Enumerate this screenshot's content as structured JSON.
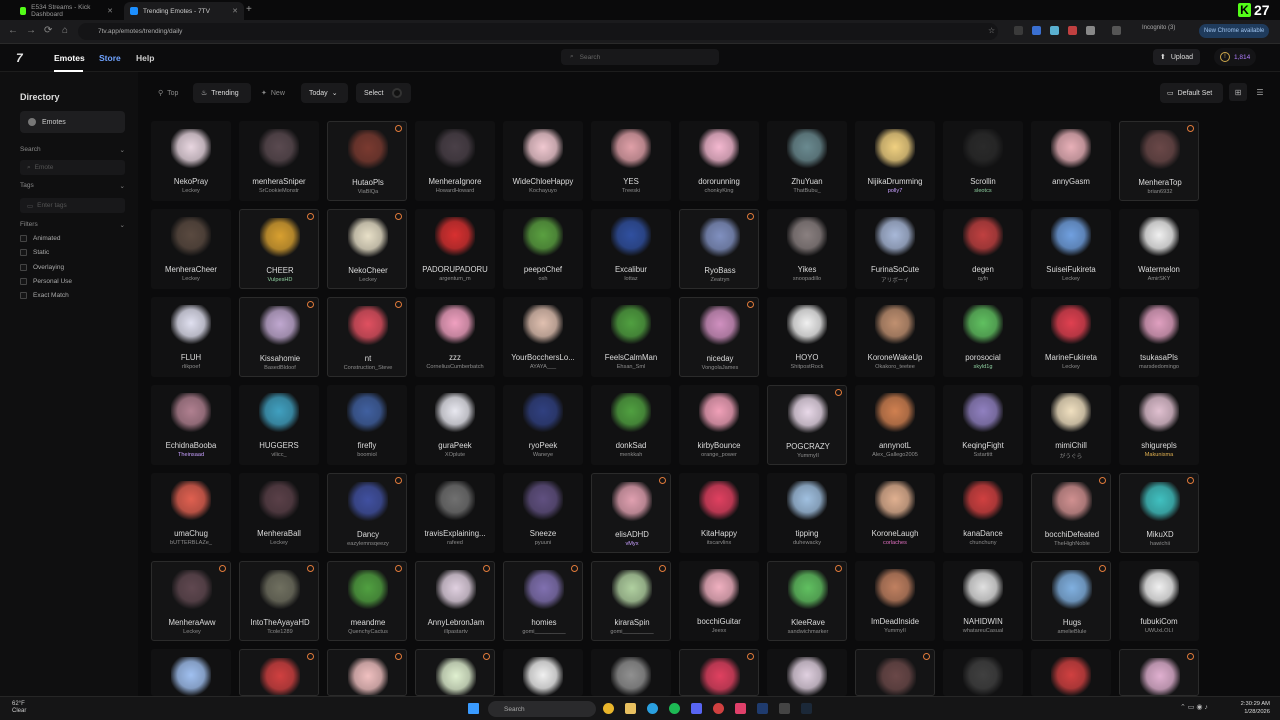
{
  "browser": {
    "tabs": [
      {
        "title": "E534 Streams - Kick Dashboard",
        "active": false
      },
      {
        "title": "Trending Emotes - 7TV",
        "active": true
      }
    ],
    "url": "7tv.app/emotes/trending/daily",
    "incognito_label": "Incognito (3)",
    "new_chrome_label": "New Chrome available",
    "overlay_badge": "27"
  },
  "header": {
    "logo": "7",
    "nav": [
      "Emotes",
      "Store",
      "Help"
    ],
    "search_placeholder": "Search",
    "upload_label": "Upload",
    "coins": "1,814"
  },
  "sidebar": {
    "title": "Directory",
    "emotes_label": "Emotes",
    "search_section": "Search",
    "search_placeholder": "Emote",
    "tags_section": "Tags",
    "tags_placeholder": "Enter tags",
    "filters_section": "Filters",
    "filters": [
      "Animated",
      "Static",
      "Overlaying",
      "Personal Use",
      "Exact Match"
    ]
  },
  "toolbar": {
    "top": "Top",
    "trending": "Trending",
    "new": "New",
    "period": "Today",
    "select": "Select",
    "default_set": "Default Set"
  },
  "emotes": [
    {
      "name": "NekoPray",
      "author": "Leckey",
      "color": "#e8d6e0",
      "bordered": false
    },
    {
      "name": "menheraSniper",
      "author": "SrCookieMonstr",
      "color": "#5a4a50",
      "bordered": false
    },
    {
      "name": "HutaoPls",
      "author": "ViaBlQa",
      "color": "#7a3a30",
      "bordered": true
    },
    {
      "name": "MenheraIgnore",
      "author": "HowardHoward",
      "color": "#4a4048",
      "bordered": false
    },
    {
      "name": "WideChloeHappy",
      "author": "Kochayuyo",
      "color": "#f0c8d0",
      "bordered": false
    },
    {
      "name": "YES",
      "author": "Treeski",
      "color": "#e0a0a8",
      "bordered": false
    },
    {
      "name": "dororunning",
      "author": "chonkyKing",
      "color": "#f4b8d0",
      "bordered": false
    },
    {
      "name": "ZhuYuan",
      "author": "ThatBubu_",
      "color": "#6a8a90",
      "bordered": false
    },
    {
      "name": "NijikaDrumming",
      "author": "polly7",
      "authorColor": "#c8a0ff",
      "color": "#f0d080",
      "bordered": false
    },
    {
      "name": "Scrollin",
      "author": "sleotcs",
      "authorColor": "#8fd0a0",
      "color": "#2a2a2a",
      "bordered": false
    },
    {
      "name": "annyGasm",
      "author": "",
      "color": "#e8b0b8",
      "bordered": false
    },
    {
      "name": "MenheraTop",
      "author": "brian6932",
      "color": "#6a4848",
      "bordered": true
    },
    {
      "name": "MenheraCheer",
      "author": "Leckey",
      "color": "#5a4a40",
      "bordered": false
    },
    {
      "name": "CHEER",
      "author": "VulpesHD",
      "authorColor": "#8fd0a0",
      "color": "#d8a030",
      "bordered": true
    },
    {
      "name": "NekoCheer",
      "author": "Leckey",
      "color": "#e8e0c8",
      "bordered": true
    },
    {
      "name": "PADORUPADORU",
      "author": "argentum_m",
      "color": "#d83030",
      "bordered": false
    },
    {
      "name": "peepoChef",
      "author": "osh",
      "color": "#5aa040",
      "bordered": false
    },
    {
      "name": "Excalibur",
      "author": "lottaz",
      "color": "#3050a0",
      "bordered": false
    },
    {
      "name": "RyoBass",
      "author": "Zeatryn",
      "color": "#8090c0",
      "bordered": true
    },
    {
      "name": "Yikes",
      "author": "snoopadillo",
      "color": "#8a8080",
      "bordered": false
    },
    {
      "name": "FurinaSoCute",
      "author": "アリボーイ",
      "color": "#a8b8d8",
      "bordered": false
    },
    {
      "name": "degen",
      "author": "qyfn",
      "color": "#c04040",
      "bordered": false
    },
    {
      "name": "SuiseiFukireta",
      "author": "Leckey",
      "color": "#70a0e0",
      "bordered": false
    },
    {
      "name": "Watermelon",
      "author": "AmirSKY",
      "color": "#f0f0f0",
      "bordered": false
    },
    {
      "name": "FLUH",
      "author": "rlikpoef",
      "color": "#e0e0f0",
      "bordered": false
    },
    {
      "name": "Kissahomie",
      "author": "BasedBldoof",
      "color": "#c0a8d0",
      "bordered": true
    },
    {
      "name": "nt",
      "author": "Construction_Steve",
      "color": "#e05060",
      "bordered": true
    },
    {
      "name": "zzz",
      "author": "CorneliusCumberbatch",
      "color": "#f0a0c0",
      "bordered": false
    },
    {
      "name": "YourBocchersLo...",
      "author": "AYAYA___",
      "color": "#e0c0b0",
      "bordered": false
    },
    {
      "name": "FeelsCalmMan",
      "author": "Ehsan_Sml",
      "color": "#50a040",
      "bordered": false
    },
    {
      "name": "niceday",
      "author": "VongolaJames",
      "color": "#d090c0",
      "bordered": true
    },
    {
      "name": "HOYO",
      "author": "ShitpostRock",
      "color": "#f0f0f0",
      "bordered": false
    },
    {
      "name": "KoroneWakeUp",
      "author": "Okakoro_teetee",
      "color": "#c09070",
      "bordered": false
    },
    {
      "name": "porosocial",
      "author": "skyld1g",
      "authorColor": "#8fd0a0",
      "color": "#60c060",
      "bordered": false
    },
    {
      "name": "MarineFukireta",
      "author": "Leckey",
      "color": "#e04050",
      "bordered": false
    },
    {
      "name": "tsukasaPls",
      "author": "marsdedomingo",
      "color": "#e0a0c0",
      "bordered": false
    },
    {
      "name": "EchidnaBooba",
      "author": "Theinsaad",
      "authorColor": "#c8a0ff",
      "color": "#b08090",
      "bordered": false
    },
    {
      "name": "HUGGERS",
      "author": "vilicc_",
      "color": "#40a0c0",
      "bordered": false
    },
    {
      "name": "firefly",
      "author": "boomiol",
      "color": "#4060a0",
      "bordered": false
    },
    {
      "name": "guraPeek",
      "author": "XOplute",
      "color": "#e8e8f0",
      "bordered": false
    },
    {
      "name": "ryoPeek",
      "author": "Waneye",
      "color": "#304080",
      "bordered": false
    },
    {
      "name": "donkSad",
      "author": "menkkah",
      "color": "#50a040",
      "bordered": false
    },
    {
      "name": "kirbyBounce",
      "author": "orange_power",
      "color": "#f0a0b8",
      "bordered": false
    },
    {
      "name": "POGCRAZY",
      "author": "YummyII",
      "color": "#e8d8e8",
      "bordered": true
    },
    {
      "name": "annynotL",
      "author": "Alex_Gallego2005",
      "color": "#d08050",
      "bordered": false
    },
    {
      "name": "KeqingFight",
      "author": "Sstartitt",
      "color": "#9080c0",
      "bordered": false
    },
    {
      "name": "mimiChill",
      "author": "がうぐら",
      "color": "#f0e0c0",
      "bordered": false
    },
    {
      "name": "shigurepls",
      "author": "Makunisma",
      "authorColor": "#e0b050",
      "color": "#e0c0d0",
      "bordered": false
    },
    {
      "name": "umaChug",
      "author": "bUTTERBLAZe_",
      "color": "#e06050",
      "bordered": false
    },
    {
      "name": "MenheraBall",
      "author": "Leckey",
      "color": "#5a4048",
      "bordered": false
    },
    {
      "name": "Dancy",
      "author": "eazylemnsqeezy",
      "color": "#4050a0",
      "bordered": true
    },
    {
      "name": "travisExplaining...",
      "author": "rafeed",
      "color": "#707070",
      "bordered": false
    },
    {
      "name": "Sneeze",
      "author": "pyuuni",
      "color": "#605080",
      "bordered": false
    },
    {
      "name": "elisADHD",
      "author": "vMyx",
      "authorColor": "#c8a0ff",
      "color": "#e0a0b0",
      "bordered": true
    },
    {
      "name": "KitaHappy",
      "author": "itscarvlinx",
      "color": "#e04060",
      "bordered": false
    },
    {
      "name": "tipping",
      "author": "duhewacky",
      "color": "#a0c0e0",
      "bordered": false
    },
    {
      "name": "KoroneLaugh",
      "author": "corlaches",
      "authorColor": "#e070c0",
      "color": "#e0b090",
      "bordered": false
    },
    {
      "name": "kanaDance",
      "author": "chunchuny",
      "color": "#d04040",
      "bordered": false
    },
    {
      "name": "bocchiDefeated",
      "author": "TheHighNoble",
      "color": "#d09090",
      "bordered": true
    },
    {
      "name": "MikuXD",
      "author": "hawichii",
      "color": "#40c0c0",
      "bordered": true
    },
    {
      "name": "MenheraAww",
      "author": "Leckey",
      "color": "#604850",
      "bordered": true
    },
    {
      "name": "IntoTheAyayaHD",
      "author": "Tcole1289",
      "color": "#707060",
      "bordered": true
    },
    {
      "name": "meandme",
      "author": "QuenchyCactus",
      "color": "#50a040",
      "bordered": true
    },
    {
      "name": "AnnyLebronJam",
      "author": "illpastartv",
      "color": "#e0d0e0",
      "bordered": true
    },
    {
      "name": "homies",
      "author": "gomi__________",
      "color": "#8070b0",
      "bordered": true
    },
    {
      "name": "kiraraSpin",
      "author": "gomi__________",
      "color": "#b0d0a0",
      "bordered": true
    },
    {
      "name": "bocchiGuitar",
      "author": "Jeexx",
      "color": "#f0b0c0",
      "bordered": false
    },
    {
      "name": "KleeRave",
      "author": "sandwichmarker",
      "color": "#60c060",
      "bordered": true
    },
    {
      "name": "ImDeadInside",
      "author": "YummyII",
      "color": "#c08060",
      "bordered": false
    },
    {
      "name": "NAHIDWIN",
      "author": "whatareuCasual",
      "color": "#e0e0e0",
      "bordered": false
    },
    {
      "name": "Hugs",
      "author": "amelieBlule",
      "color": "#80b0e0",
      "bordered": true
    },
    {
      "name": "fubukiCom",
      "author": "UWUxLOLI",
      "color": "#f0f0f0",
      "bordered": false
    },
    {
      "name": "",
      "author": "",
      "color": "#a0c0f0",
      "bordered": false
    },
    {
      "name": "",
      "author": "",
      "color": "#d04040",
      "bordered": true
    },
    {
      "name": "",
      "author": "",
      "color": "#f0c0c0",
      "bordered": true
    },
    {
      "name": "",
      "author": "",
      "color": "#e0f0d0",
      "bordered": true
    },
    {
      "name": "",
      "author": "",
      "color": "#f0f0f0",
      "bordered": false
    },
    {
      "name": "",
      "author": "",
      "color": "#909090",
      "bordered": false
    },
    {
      "name": "",
      "author": "",
      "color": "#e04060",
      "bordered": true
    },
    {
      "name": "",
      "author": "",
      "color": "#e0d0e0",
      "bordered": false
    },
    {
      "name": "",
      "author": "",
      "color": "#6a4848",
      "bordered": true
    },
    {
      "name": "",
      "author": "",
      "color": "#404040",
      "bordered": false
    },
    {
      "name": "",
      "author": "",
      "color": "#d04040",
      "bordered": false
    },
    {
      "name": "",
      "author": "",
      "color": "#e0b0d0",
      "bordered": true
    }
  ],
  "taskbar": {
    "weather_temp": "62°F",
    "weather_desc": "Clear",
    "search": "Search",
    "time": "2:30:29 AM",
    "date": "1/28/2026"
  },
  "colors": {
    "accent": "#a678ff",
    "store": "#6fa3ff"
  }
}
